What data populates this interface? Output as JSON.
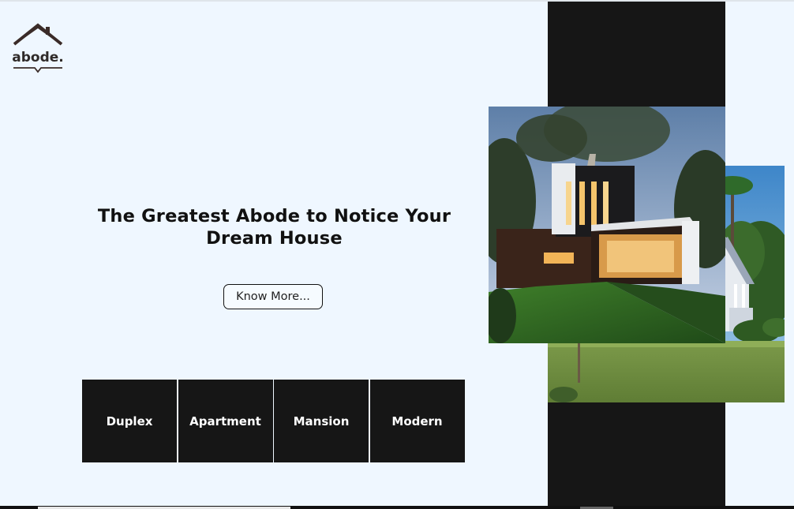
{
  "brand": {
    "logo_text": "abode."
  },
  "hero": {
    "title": "The Greatest Abode to Notice Your Dream House",
    "button_label": "Know More..."
  },
  "categories": [
    {
      "label": "Duplex"
    },
    {
      "label": "Apartment"
    },
    {
      "label": "Mansion"
    },
    {
      "label": "Modern"
    }
  ],
  "images": {
    "front": "modern-house-photo",
    "back": "victorian-house-lawn-photo"
  },
  "colors": {
    "background": "#eff7ff",
    "dark": "#161616",
    "text": "#111111"
  }
}
